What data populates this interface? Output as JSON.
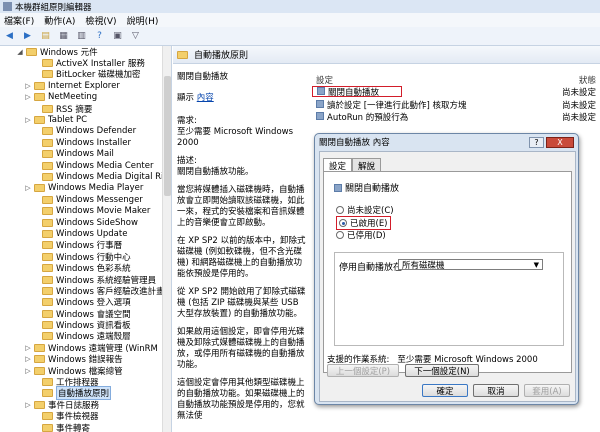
{
  "window": {
    "title": "本機群組原則編輯器"
  },
  "menu": [
    "檔案(F)",
    "動作(A)",
    "檢視(V)",
    "說明(H)"
  ],
  "tree": {
    "items": [
      {
        "label": "Windows 元件",
        "indent": 2,
        "expander": "◢"
      },
      {
        "label": "ActiveX Installer 服務",
        "indent": 4,
        "expander": ""
      },
      {
        "label": "BitLocker 磁碟機加密",
        "indent": 4,
        "expander": ""
      },
      {
        "label": "Internet Explorer",
        "indent": 3,
        "expander": "▷"
      },
      {
        "label": "NetMeeting",
        "indent": 3,
        "expander": "▷"
      },
      {
        "label": "RSS 摘要",
        "indent": 4,
        "expander": ""
      },
      {
        "label": "Tablet PC",
        "indent": 3,
        "expander": "▷"
      },
      {
        "label": "Windows Defender",
        "indent": 4,
        "expander": ""
      },
      {
        "label": "Windows Installer",
        "indent": 4,
        "expander": ""
      },
      {
        "label": "Windows Mail",
        "indent": 4,
        "expander": ""
      },
      {
        "label": "Windows Media Center",
        "indent": 4,
        "expander": ""
      },
      {
        "label": "Windows Media Digital Ri",
        "indent": 4,
        "expander": ""
      },
      {
        "label": "Windows Media Player",
        "indent": 3,
        "expander": "▷"
      },
      {
        "label": "Windows Messenger",
        "indent": 4,
        "expander": ""
      },
      {
        "label": "Windows Movie Maker",
        "indent": 4,
        "expander": ""
      },
      {
        "label": "Windows SideShow",
        "indent": 4,
        "expander": ""
      },
      {
        "label": "Windows Update",
        "indent": 4,
        "expander": ""
      },
      {
        "label": "Windows 行事曆",
        "indent": 4,
        "expander": ""
      },
      {
        "label": "Windows 行動中心",
        "indent": 4,
        "expander": ""
      },
      {
        "label": "Windows 色彩系統",
        "indent": 4,
        "expander": ""
      },
      {
        "label": "Windows 系統經驗管理員",
        "indent": 4,
        "expander": ""
      },
      {
        "label": "Windows 客戶經驗改進計畫",
        "indent": 4,
        "expander": ""
      },
      {
        "label": "Windows 登入選項",
        "indent": 4,
        "expander": ""
      },
      {
        "label": "Windows 會議空間",
        "indent": 4,
        "expander": ""
      },
      {
        "label": "Windows 資訊看板",
        "indent": 4,
        "expander": ""
      },
      {
        "label": "Windows 遠端殼層",
        "indent": 4,
        "expander": ""
      },
      {
        "label": "Windows 遠端管理 (WinRM",
        "indent": 3,
        "expander": "▷"
      },
      {
        "label": "Windows 錯誤報告",
        "indent": 3,
        "expander": "▷"
      },
      {
        "label": "Windows 檔案總管",
        "indent": 3,
        "expander": "▷"
      },
      {
        "label": "工作排程器",
        "indent": 4,
        "expander": ""
      },
      {
        "label": "自動播放原則",
        "indent": 4,
        "expander": "",
        "selected": true
      },
      {
        "label": "事件日誌服務",
        "indent": 3,
        "expander": "▷"
      },
      {
        "label": "事件檢視器",
        "indent": 4,
        "expander": ""
      },
      {
        "label": "事件轉寄",
        "indent": 4,
        "expander": ""
      }
    ]
  },
  "pane": {
    "header": "自動播放原則",
    "policy_title": "關閉自動播放",
    "display_label": "顯示",
    "display_link": "內容",
    "req_label": "需求:",
    "req_value": "至少需要 Microsoft Windows 2000",
    "desc_label": "描述:",
    "desc_1": "關閉自動播放功能。",
    "desc_2": "當您將媒體插入磁碟機時，自動播放會立即開始讀取該磁碟機，如此一來，程式的安裝檔案和音訊媒體上的音樂便會立即啟動。",
    "desc_3": "在 XP SP2 以前的版本中，卸除式磁碟機 (例如軟碟機，但不含光碟機) 和網路磁碟機上的自動播放功能依預設是停用的。",
    "desc_4": "從 XP SP2 開始啟用了卸除式磁碟機 (包括 ZIP 磁碟機與某些 USB 大型存放裝置) 的自動播放功能。",
    "desc_5": "如果啟用這個設定，即會停用光碟機及卸除式媒體磁碟機上的自動播放，或停用所有磁碟機的自動播放功能。",
    "desc_6": "這個設定會停用其他類型磁碟機上的自動播放功能。如果磁碟機上的自動播放功能預設是停用的，您就無法使",
    "list_header_setting": "設定",
    "list_header_state": "狀態",
    "rows": [
      {
        "name": "關閉自動播放",
        "state": "尚未設定"
      },
      {
        "name": "讀於設定 [一律進行此動作] 核取方塊",
        "state": "尚未設定"
      },
      {
        "name": "AutoRun 的預設行為",
        "state": "尚未設定"
      }
    ]
  },
  "dialog": {
    "title": "關閉自動播放 內容",
    "tab_settings": "設定",
    "tab_explain": "解說",
    "policy_name": "關閉自動播放",
    "opt_not_configured": "尚未設定(C)",
    "opt_enabled": "已啟用(E)",
    "opt_disabled": "已停用(D)",
    "turn_off_label": "停用自動播放在:",
    "turn_off_value": "所有磁碟機",
    "supported_label": "支援的作業系統:",
    "supported_value": "至少需要 Microsoft Windows 2000",
    "prev_button": "上一個設定(P)",
    "next_button": "下一個設定(N)",
    "ok": "確定",
    "cancel": "取消",
    "apply": "套用(A)",
    "help": "?",
    "close": "X"
  }
}
